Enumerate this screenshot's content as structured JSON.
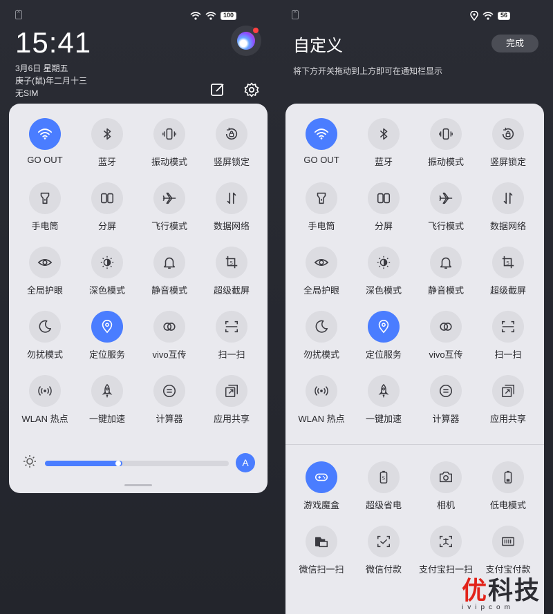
{
  "left": {
    "status": {
      "battery": "100"
    },
    "time": "15:41",
    "date": "3月6日 星期五",
    "lunar": "庚子(鼠)年二月十三",
    "sim": "无SIM",
    "tiles": [
      {
        "label": "GO OUT",
        "icon": "wifi-icon",
        "active": true
      },
      {
        "label": "蓝牙",
        "icon": "bluetooth-icon",
        "active": false
      },
      {
        "label": "振动模式",
        "icon": "vibrate-icon",
        "active": false
      },
      {
        "label": "竖屏锁定",
        "icon": "rotation-lock-icon",
        "active": false
      },
      {
        "label": "手电筒",
        "icon": "flashlight-icon",
        "active": false
      },
      {
        "label": "分屏",
        "icon": "split-screen-icon",
        "active": false
      },
      {
        "label": "飞行模式",
        "icon": "airplane-icon",
        "active": false
      },
      {
        "label": "数据网络",
        "icon": "mobile-data-icon",
        "active": false
      },
      {
        "label": "全局护眼",
        "icon": "eye-icon",
        "active": false
      },
      {
        "label": "深色模式",
        "icon": "dark-mode-icon",
        "active": false
      },
      {
        "label": "静音模式",
        "icon": "bell-icon",
        "active": false
      },
      {
        "label": "超级截屏",
        "icon": "screenshot-icon",
        "active": false
      },
      {
        "label": "勿扰模式",
        "icon": "moon-icon",
        "active": false
      },
      {
        "label": "定位服务",
        "icon": "location-icon",
        "active": true
      },
      {
        "label": "vivo互传",
        "icon": "share-rings-icon",
        "active": false
      },
      {
        "label": "扫一扫",
        "icon": "scan-icon",
        "active": false
      },
      {
        "label": "WLAN 热点",
        "icon": "hotspot-icon",
        "active": false
      },
      {
        "label": "一键加速",
        "icon": "rocket-icon",
        "active": false
      },
      {
        "label": "计算器",
        "icon": "calculator-icon",
        "active": false
      },
      {
        "label": "应用共享",
        "icon": "app-share-icon",
        "active": false
      }
    ],
    "brightness": {
      "level": 0.42,
      "auto_label": "A"
    }
  },
  "right": {
    "status": {
      "battery": "56"
    },
    "title": "自定义",
    "done_label": "完成",
    "hint": "将下方开关拖动到上方即可在通知栏显示",
    "tiles": [
      {
        "label": "GO OUT",
        "icon": "wifi-icon",
        "active": true
      },
      {
        "label": "蓝牙",
        "icon": "bluetooth-icon",
        "active": false
      },
      {
        "label": "振动模式",
        "icon": "vibrate-icon",
        "active": false
      },
      {
        "label": "竖屏锁定",
        "icon": "rotation-lock-icon",
        "active": false
      },
      {
        "label": "手电筒",
        "icon": "flashlight-icon",
        "active": false
      },
      {
        "label": "分屏",
        "icon": "split-screen-icon",
        "active": false
      },
      {
        "label": "飞行模式",
        "icon": "airplane-icon",
        "active": false
      },
      {
        "label": "数据网络",
        "icon": "mobile-data-icon",
        "active": false
      },
      {
        "label": "全局护眼",
        "icon": "eye-icon",
        "active": false
      },
      {
        "label": "深色模式",
        "icon": "dark-mode-icon",
        "active": false
      },
      {
        "label": "静音模式",
        "icon": "bell-icon",
        "active": false
      },
      {
        "label": "超级截屏",
        "icon": "screenshot-icon",
        "active": false
      },
      {
        "label": "勿扰模式",
        "icon": "moon-icon",
        "active": false
      },
      {
        "label": "定位服务",
        "icon": "location-icon",
        "active": true
      },
      {
        "label": "vivo互传",
        "icon": "share-rings-icon",
        "active": false
      },
      {
        "label": "扫一扫",
        "icon": "scan-icon",
        "active": false
      },
      {
        "label": "WLAN 热点",
        "icon": "hotspot-icon",
        "active": false
      },
      {
        "label": "一键加速",
        "icon": "rocket-icon",
        "active": false
      },
      {
        "label": "计算器",
        "icon": "calculator-icon",
        "active": false
      },
      {
        "label": "应用共享",
        "icon": "app-share-icon",
        "active": false
      }
    ],
    "extra_tiles": [
      {
        "label": "游戏魔盒",
        "icon": "gamepad-icon",
        "active": true
      },
      {
        "label": "超级省电",
        "icon": "power-saver-icon",
        "active": false
      },
      {
        "label": "相机",
        "icon": "camera-icon",
        "active": false
      },
      {
        "label": "低电模式",
        "icon": "low-battery-icon",
        "active": false
      },
      {
        "label": "微信扫一扫",
        "icon": "wechat-scan-icon",
        "active": false
      },
      {
        "label": "微信付款",
        "icon": "wechat-pay-icon",
        "active": false
      },
      {
        "label": "支付宝扫一扫",
        "icon": "alipay-scan-icon",
        "active": false
      },
      {
        "label": "支付宝付款",
        "icon": "alipay-pay-icon",
        "active": false
      }
    ]
  },
  "watermark": {
    "text_accent": "优",
    "text": "科技",
    "url": "ivipcom"
  },
  "colors": {
    "accent": "#4a7dff",
    "panel": "#e9e9ee",
    "background": "#24252b"
  }
}
